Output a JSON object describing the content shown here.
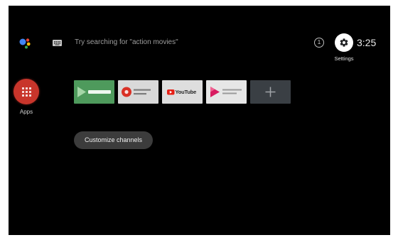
{
  "search": {
    "hint": "Try searching for \"action movies\"",
    "assistant_icon": "google-assistant-icon",
    "keyboard_icon": "keyboard-icon"
  },
  "status": {
    "notification_count": "1",
    "settings_icon": "gear-icon",
    "settings_label": "Settings",
    "time": "3:25"
  },
  "apps": {
    "label": "Apps",
    "icon": "apps-grid-icon",
    "color": "#c8352b"
  },
  "app_row": {
    "tiles": [
      {
        "icon": "green-play-app-banner",
        "bg": "#4e9a5c"
      },
      {
        "icon": "red-circle-app-banner",
        "bg": "#d9d9d9"
      },
      {
        "icon": "youtube-logo",
        "wordmark": "YouTube",
        "bg": "#dedede"
      },
      {
        "icon": "pink-play-app-banner",
        "bg": "#e6e6e6"
      },
      {
        "icon": "plus-icon",
        "bg": "#3a3f44"
      }
    ]
  },
  "customize_channels": {
    "label": "Customize channels",
    "bg": "#3c3c3c"
  },
  "colors": {
    "screen_background": "#000000",
    "frame": "#ffffff",
    "hint_text": "#9e9e9e"
  }
}
